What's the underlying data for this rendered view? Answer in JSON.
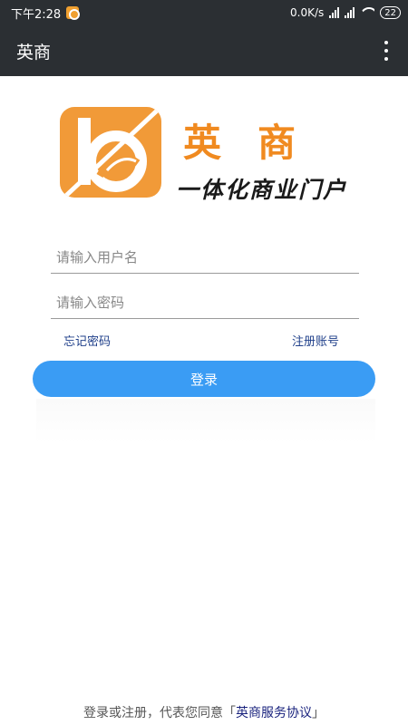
{
  "status_bar": {
    "time": "下午2:28",
    "network_speed": "0.0K/s",
    "battery": "22"
  },
  "app_bar": {
    "title": "英商"
  },
  "brand": {
    "name": "英商",
    "slogan": "一体化商业门户",
    "accent_color": "#f08a20"
  },
  "form": {
    "username_placeholder": "请输入用户名",
    "username_value": "",
    "password_placeholder": "请输入密码",
    "password_value": "",
    "forgot_password": "忘记密码",
    "register": "注册账号",
    "login_button": "登录",
    "button_color": "#3a9cf4"
  },
  "footer": {
    "agreement_prefix": "登录或注册，代表您同意「",
    "agreement_link": "英商服务协议",
    "agreement_suffix": "」"
  }
}
